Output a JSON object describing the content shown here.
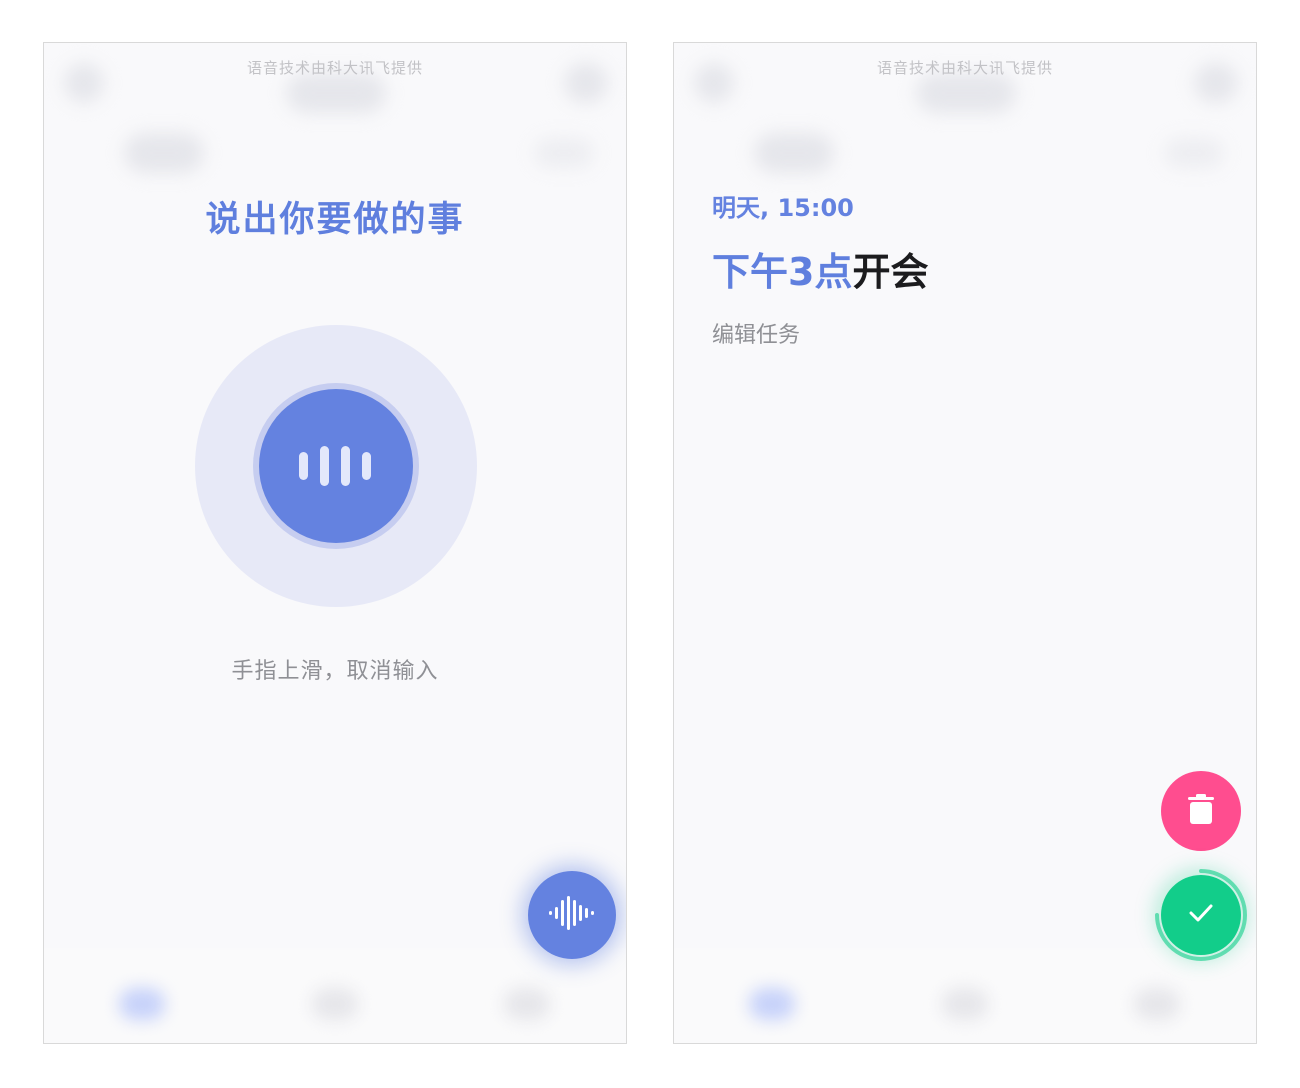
{
  "left_screen": {
    "credit": "语音技术由科大讯飞提供",
    "prompt_title": "说出你要做的事",
    "cancel_hint": "手指上滑，取消输入",
    "icons": {
      "mic": "voice-wave-icon",
      "fab": "voice-waveform-icon"
    },
    "colors": {
      "accent": "#6482e0",
      "title": "#5f7fde",
      "hint": "#8f9095"
    }
  },
  "right_screen": {
    "credit": "语音技术由科大讯飞提供",
    "date": "明天, 15:00",
    "title_highlight": "下午3点",
    "title_rest": "开会",
    "edit_label": "编辑任务",
    "icons": {
      "delete": "trash-icon",
      "confirm": "checkmark-icon"
    },
    "colors": {
      "delete": "#ff4d8f",
      "confirm": "#12cd8a"
    }
  }
}
